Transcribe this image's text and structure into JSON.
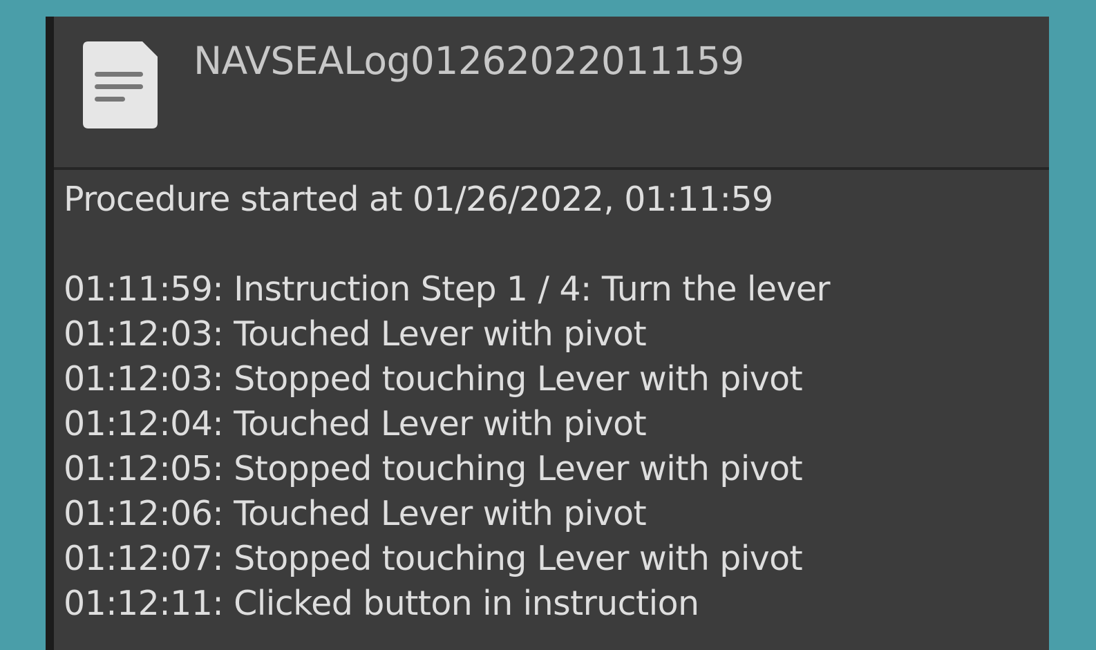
{
  "file": {
    "icon": "document-icon",
    "title": "NAVSEALog01262022011159"
  },
  "log": {
    "header": "Procedure started at 01/26/2022, 01:11:59",
    "entries": [
      "01:11:59: Instruction Step 1 / 4: Turn the lever",
      "01:12:03: Touched Lever with pivot",
      "01:12:03: Stopped touching Lever with pivot",
      "01:12:04: Touched Lever with pivot",
      "01:12:05: Stopped touching Lever with pivot",
      "01:12:06: Touched Lever with pivot",
      "01:12:07: Stopped touching Lever with pivot",
      "01:12:11: Clicked button in instruction"
    ]
  },
  "colors": {
    "background": "#4a9ea9",
    "panel": "#3c3c3c",
    "text": "#dedede",
    "title": "#c8c8c8"
  }
}
